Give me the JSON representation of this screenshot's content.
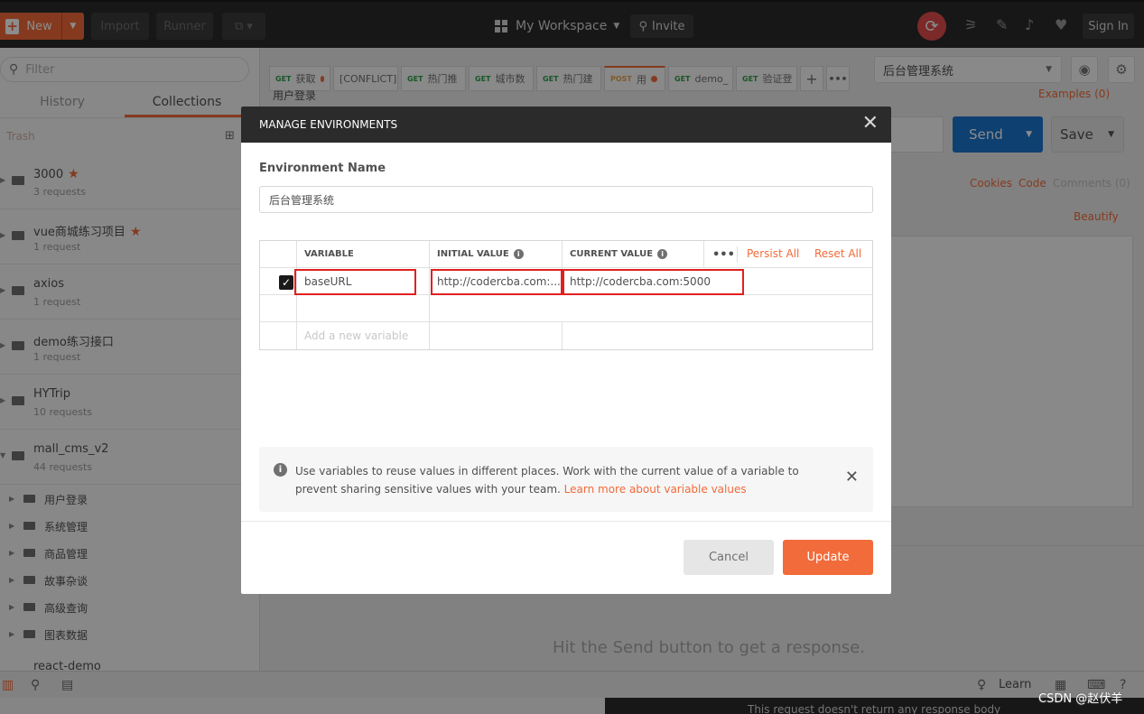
{
  "header": {
    "new_label": "New",
    "import_label": "Import",
    "runner_label": "Runner",
    "workspace_label": "My Workspace",
    "invite_label": "Invite",
    "signin_label": "Sign In",
    "accent_color": "#f26b3a"
  },
  "sidebar": {
    "filter_placeholder": "Filter",
    "tabs": [
      "History",
      "Collections"
    ],
    "active_tab": "Collections",
    "trash_label": "Trash",
    "collections": [
      {
        "name": "3000",
        "count": "3 requests",
        "starred": true
      },
      {
        "name": "vue商城练习项目",
        "count": "1 request",
        "starred": true
      },
      {
        "name": "axios",
        "count": "1 request",
        "starred": false
      },
      {
        "name": "demo练习接口",
        "count": "1 request",
        "starred": false
      },
      {
        "name": "HYTrip",
        "count": "10 requests",
        "starred": false
      },
      {
        "name": "mall_cms_v2",
        "count": "44 requests",
        "starred": false
      }
    ],
    "folders": [
      "用户登录",
      "系统管理",
      "商品管理",
      "故事杂谈",
      "高级查询",
      "图表数据"
    ],
    "last_collection": "react-demo"
  },
  "request_tabs": [
    {
      "method": "GET",
      "label": "获取",
      "dot": true
    },
    {
      "method": "",
      "label": "[CONFLICT]",
      "dot": false
    },
    {
      "method": "GET",
      "label": "热门推",
      "dot": false
    },
    {
      "method": "GET",
      "label": "城市数",
      "dot": false
    },
    {
      "method": "GET",
      "label": "热门建",
      "dot": false
    },
    {
      "method": "POST",
      "label": "用",
      "dot": true
    },
    {
      "method": "GET",
      "label": "demo_",
      "dot": false
    },
    {
      "method": "GET",
      "label": "验证登",
      "dot": false
    }
  ],
  "request": {
    "breadcrumb": "用户登录",
    "examples_label": "Examples (0)",
    "send_label": "Send",
    "save_label": "Save",
    "cookies_label": "Cookies",
    "code_label": "Code",
    "comments_label": "Comments (0)",
    "beautify_label": "Beautify",
    "empty_response_hint": "Hit the Send button to get a response."
  },
  "environment_selector": {
    "selected": "后台管理系统"
  },
  "modal": {
    "title": "MANAGE ENVIRONMENTS",
    "env_name_label": "Environment Name",
    "env_name_value": "后台管理系统",
    "columns": {
      "variable": "VARIABLE",
      "initial": "INITIAL VALUE",
      "current": "CURRENT VALUE"
    },
    "persist_all": "Persist All",
    "reset_all": "Reset All",
    "variables": [
      {
        "enabled": true,
        "variable": "baseURL",
        "initial": "http://codercba.com:...",
        "current": "http://codercba.com:5000"
      }
    ],
    "add_placeholder": "Add a new variable",
    "info_text": "Use variables to reuse values in different places. Work with the current value of a variable to prevent sharing sensitive values with your team.",
    "info_link": "Learn more about variable values",
    "cancel_label": "Cancel",
    "update_label": "Update"
  },
  "statusbar": {
    "learn_label": "Learn",
    "bottom_text": "This request doesn't return any response body"
  },
  "watermark": "CSDN @赵伏羊"
}
